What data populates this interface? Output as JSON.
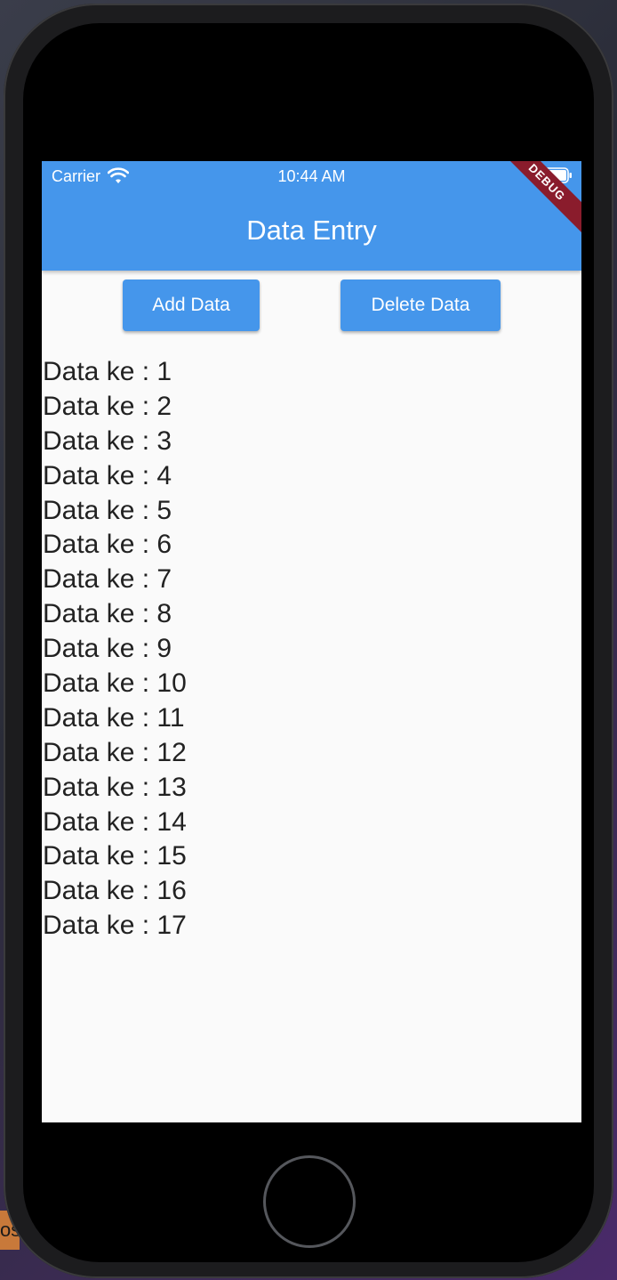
{
  "status_bar": {
    "carrier": "Carrier",
    "time": "10:44 AM"
  },
  "app_bar": {
    "title": "Data Entry",
    "debug_label": "DEBUG"
  },
  "buttons": {
    "add_label": "Add Data",
    "delete_label": "Delete Data"
  },
  "list_items": [
    "Data ke : 1",
    "Data ke : 2",
    "Data ke : 3",
    "Data ke : 4",
    "Data ke : 5",
    "Data ke : 6",
    "Data ke : 7",
    "Data ke : 8",
    "Data ke : 9",
    "Data ke : 10",
    "Data ke : 11",
    "Data ke : 12",
    "Data ke : 13",
    "Data ke : 14",
    "Data ke : 15",
    "Data ke : 16",
    "Data ke : 17"
  ],
  "desktop_tab_text": "os",
  "colors": {
    "primary": "#4596eb",
    "debug_banner": "#8a1c2c",
    "screen_bg": "#fafafa"
  },
  "icons": [
    "wifi-icon",
    "battery-icon",
    "home-button"
  ]
}
